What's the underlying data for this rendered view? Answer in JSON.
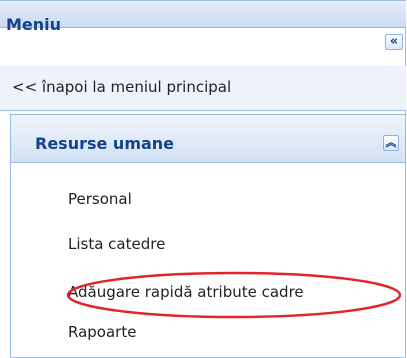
{
  "menu": {
    "title": "Meniu",
    "collapse_icon_glyph": "«",
    "back_link": "<< înapoi la meniul principal"
  },
  "section": {
    "title": "Resurse umane",
    "collapse_icon_glyph": "︽",
    "items": [
      {
        "label": "Personal"
      },
      {
        "label": "Lista catedre"
      },
      {
        "label": "Adăugare rapidă atribute cadre"
      },
      {
        "label": "Rapoarte"
      }
    ]
  },
  "colors": {
    "header_text": "#15428b",
    "border": "#99bbe8",
    "annotation": "#e0262d"
  }
}
